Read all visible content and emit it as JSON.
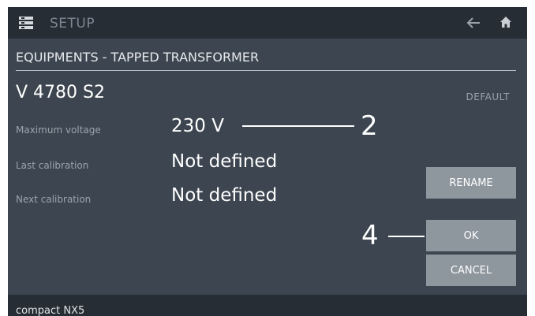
{
  "header": {
    "title": "SETUP",
    "menu_icon": "menu-list-icon",
    "back_icon": "back-arrow-icon",
    "home_icon": "home-icon"
  },
  "page": {
    "subtitle": "EQUIPMENTS - TAPPED TRANSFORMER",
    "device_name": "V 4780 S2",
    "default_label": "DEFAULT"
  },
  "fields": [
    {
      "label": "Maximum voltage",
      "value": "230 V"
    },
    {
      "label": "Last calibration",
      "value": "Not defined"
    },
    {
      "label": "Next calibration",
      "value": "Not defined"
    }
  ],
  "callouts": {
    "voltage": "2",
    "ok": "4"
  },
  "buttons": {
    "rename": "RENAME",
    "ok": "OK",
    "cancel": "CANCEL"
  },
  "footer": {
    "text": "compact NX5"
  },
  "colors": {
    "background": "#3d4650",
    "topbar": "#262d35",
    "button": "#8e969e"
  }
}
